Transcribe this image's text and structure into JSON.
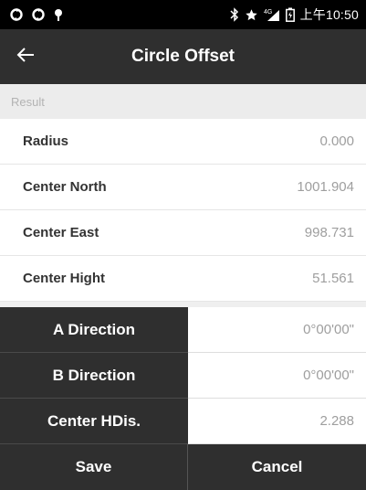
{
  "status_bar": {
    "left_icons": [
      "sync-icon",
      "sync-icon",
      "location-pin-icon"
    ],
    "right_icons": [
      "bluetooth-icon",
      "star-icon",
      "4g-signal-icon",
      "battery-icon"
    ],
    "signal_label": "4G",
    "time": "上午10:50"
  },
  "app_bar": {
    "title": "Circle Offset",
    "back_icon": "arrow-left-icon"
  },
  "result_section": {
    "header": "Result",
    "rows": [
      {
        "label": "Radius",
        "value": "0.000"
      },
      {
        "label": "Center North",
        "value": "1001.904"
      },
      {
        "label": "Center East",
        "value": "998.731"
      },
      {
        "label": "Center Hight",
        "value": "51.561"
      }
    ]
  },
  "parameters": [
    {
      "label": "A Direction",
      "value": "0°00'00\""
    },
    {
      "label": "B Direction",
      "value": "0°00'00\""
    },
    {
      "label": "Center HDis.",
      "value": "2.288"
    }
  ],
  "buttons": {
    "save": "Save",
    "cancel": "Cancel"
  },
  "colors": {
    "status_bar_bg": "#000000",
    "app_bar_bg": "#2f2f2f",
    "section_header_bg": "#ececec",
    "value_text": "#9e9e9e"
  }
}
